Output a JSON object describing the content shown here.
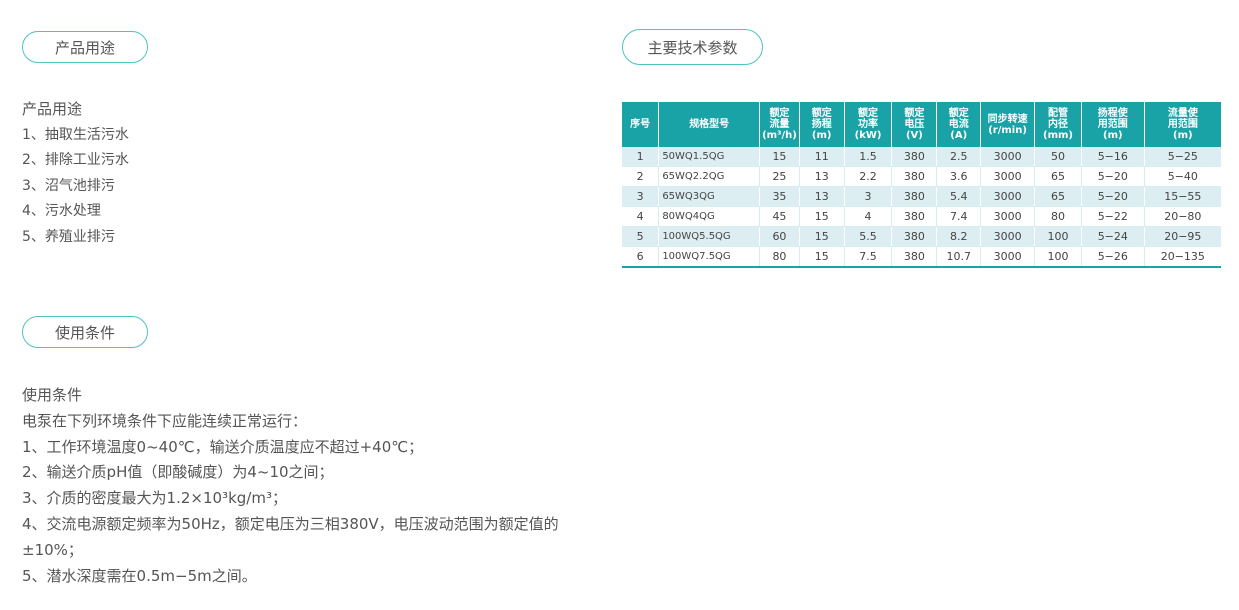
{
  "sections": {
    "usage_tab": "产品用途",
    "params_tab": "主要技术参数",
    "conditions_tab": "使用条件"
  },
  "usage": {
    "title": "产品用途",
    "items": [
      "1、抽取生活污水",
      "2、排除工业污水",
      "3、沼气池排污",
      "4、污水处理",
      "5、养殖业排污"
    ]
  },
  "conditions": {
    "title": "使用条件",
    "intro": "电泵在下列环境条件下应能连续正常运行：",
    "items": [
      "1、工作环境温度0~40℃，输送介质温度应不超过+40℃；",
      "2、输送介质pH值（即酸碱度）为4~10之间；",
      "3、介质的密度最大为1.2×10³kg/m³；",
      "4、交流电源额定频率为50Hz，额定电压为三相380V，电压波动范围为额定值的±10%；",
      "5、潜水深度需在0.5m−5m之间。"
    ]
  },
  "table": {
    "headers": [
      [
        "序号"
      ],
      [
        "规格型号"
      ],
      [
        "额定",
        "流量",
        "(m³/h)"
      ],
      [
        "额定",
        "扬程",
        "(m)"
      ],
      [
        "额定",
        "功率",
        "(kW)"
      ],
      [
        "额定",
        "电压",
        "(V)"
      ],
      [
        "额定",
        "电流",
        "(A)"
      ],
      [
        "同步转速",
        "(r/min)"
      ],
      [
        "配管",
        "内径",
        "(mm)"
      ],
      [
        "扬程使",
        "用范围",
        "(m)"
      ],
      [
        "流量使",
        "用范围",
        "(m)"
      ]
    ],
    "rows": [
      [
        "1",
        "50WQ1.5QG",
        "15",
        "11",
        "1.5",
        "380",
        "2.5",
        "3000",
        "50",
        "5−16",
        "5−25"
      ],
      [
        "2",
        "65WQ2.2QG",
        "25",
        "13",
        "2.2",
        "380",
        "3.6",
        "3000",
        "65",
        "5−20",
        "5−40"
      ],
      [
        "3",
        "65WQ3QG",
        "35",
        "13",
        "3",
        "380",
        "5.4",
        "3000",
        "65",
        "5−20",
        "15−55"
      ],
      [
        "4",
        "80WQ4QG",
        "45",
        "15",
        "4",
        "380",
        "7.4",
        "3000",
        "80",
        "5−22",
        "20−80"
      ],
      [
        "5",
        "100WQ5.5QG",
        "60",
        "15",
        "5.5",
        "380",
        "8.2",
        "3000",
        "100",
        "5−24",
        "20−95"
      ],
      [
        "6",
        "100WQ7.5QG",
        "80",
        "15",
        "7.5",
        "380",
        "10.7",
        "3000",
        "100",
        "5−26",
        "20−135"
      ]
    ]
  }
}
